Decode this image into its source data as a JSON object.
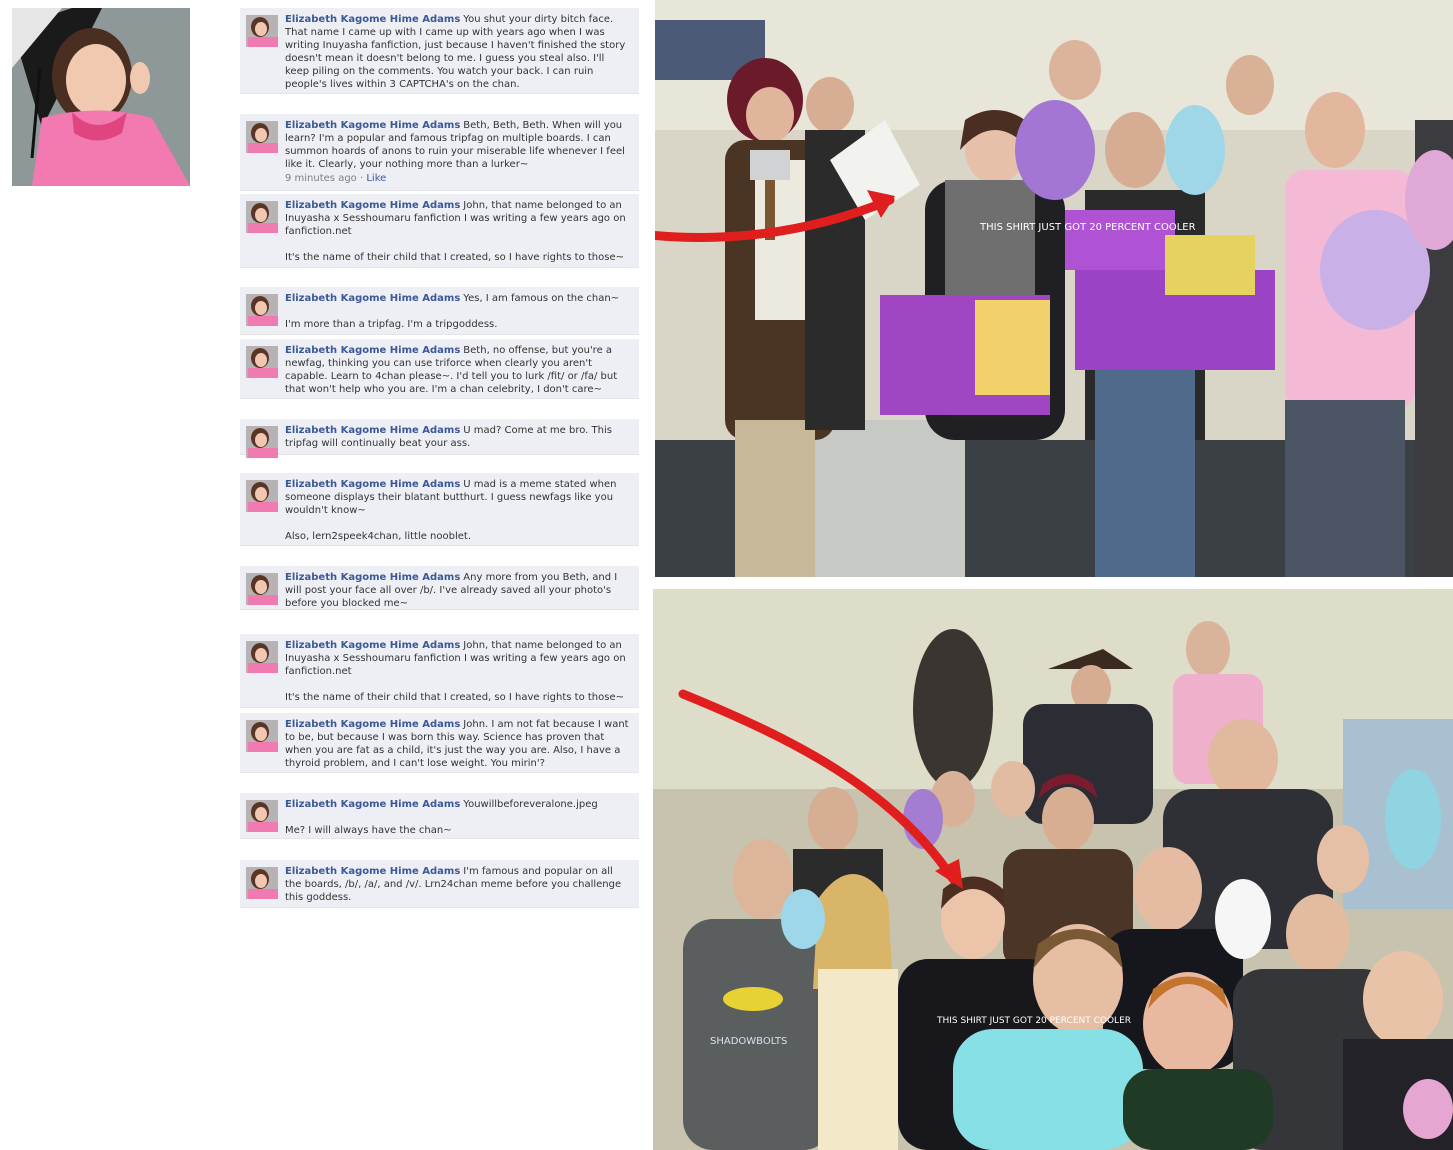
{
  "comments": [
    {
      "author": "Elizabeth Kagome Hime Adams",
      "text": "You shut your dirty bitch face. That name I came up with I came up with years ago when I was writing Inuyasha fanfiction, just because I haven't finished the story doesn't mean it doesn't belong to me. I guess you steal also. I'll keep piling on the comments. You watch your back. I can ruin people's lives within 3 CAPTCHA's on the chan.",
      "text2": ""
    },
    {
      "author": "Elizabeth Kagome Hime Adams",
      "text": "Beth, Beth, Beth. When will you learn? I'm a popular and famous tripfag on multiple boards. I can summon hoards of anons to ruin your miserable life whenever I feel like it. Clearly, your nothing more than a lurker~",
      "text2": "",
      "time": "9 minutes ago",
      "sep": " · ",
      "like": "Like"
    },
    {
      "author": "Elizabeth Kagome Hime Adams",
      "text": "John, that name belonged to an Inuyasha x Sesshoumaru fanfiction I was writing a few years ago on fanfiction.net",
      "text2": "It's the name of their child that I created, so I have rights to those~"
    },
    {
      "author": "Elizabeth Kagome Hime Adams",
      "text": "Yes, I am famous on the chan~",
      "text2": "I'm more than a tripfag. I'm a tripgoddess."
    },
    {
      "author": "Elizabeth Kagome Hime Adams",
      "text": "Beth, no offense, but you're a newfag, thinking you can use triforce when clearly you aren't capable. Learn to 4chan please~. I'd tell you to lurk /fit/ or /fa/ but that won't help who you are. I'm a chan celebrity, I don't care~",
      "text2": ""
    },
    {
      "author": "Elizabeth Kagome Hime Adams",
      "text": "U mad? Come at me bro. This tripfag will continually beat your ass.",
      "text2": ""
    },
    {
      "author": "Elizabeth Kagome Hime Adams",
      "text": "U mad is a meme stated when someone displays their blatant butthurt. I guess newfags like you wouldn't know~",
      "text2": "Also, lern2speek4chan, little nooblet."
    },
    {
      "author": "Elizabeth Kagome Hime Adams",
      "text": "Any more from you Beth, and I will post your face all over /b/. I've already saved all your photo's before you blocked me~",
      "text2": ""
    },
    {
      "author": "Elizabeth Kagome Hime Adams",
      "text": "John, that name belonged to an Inuyasha x Sesshoumaru fanfiction I was writing a few years ago on fanfiction.net",
      "text2": "It's the name of their child that I created, so I have rights to those~"
    },
    {
      "author": "Elizabeth Kagome Hime Adams",
      "text": "John. I am not fat because I want to be, but because I was born this way. Science has proven that when you are fat as a child, it's just the way you are. Also, I have a thyroid problem, and I can't lose weight. You mirin'?",
      "text2": ""
    },
    {
      "author": "Elizabeth Kagome Hime Adams",
      "text": "Youwillbeforeveralone.jpeg",
      "text2": "Me? I will always have the chan~"
    },
    {
      "author": "Elizabeth Kagome Hime Adams",
      "text": "I'm famous and popular on all the boards, /b/, /a/, and /v/. Lrn24chan meme before you challenge this goddess.",
      "text2": ""
    }
  ],
  "photos": {
    "top": {
      "shirt_text": "THIS SHIRT JUST GOT 20 PERCENT COOLER",
      "arrow_color": "#e01e1e"
    },
    "bottom": {
      "shirt_text": "THIS SHIRT JUST GOT 20 PERCENT COOLER",
      "shadowbolts": "SHADOWBOLTS",
      "arrow_color": "#e01e1e"
    }
  },
  "colors": {
    "author_link": "#3b5998",
    "comment_bg": "#edeff4",
    "arrow": "#e01e1e"
  }
}
